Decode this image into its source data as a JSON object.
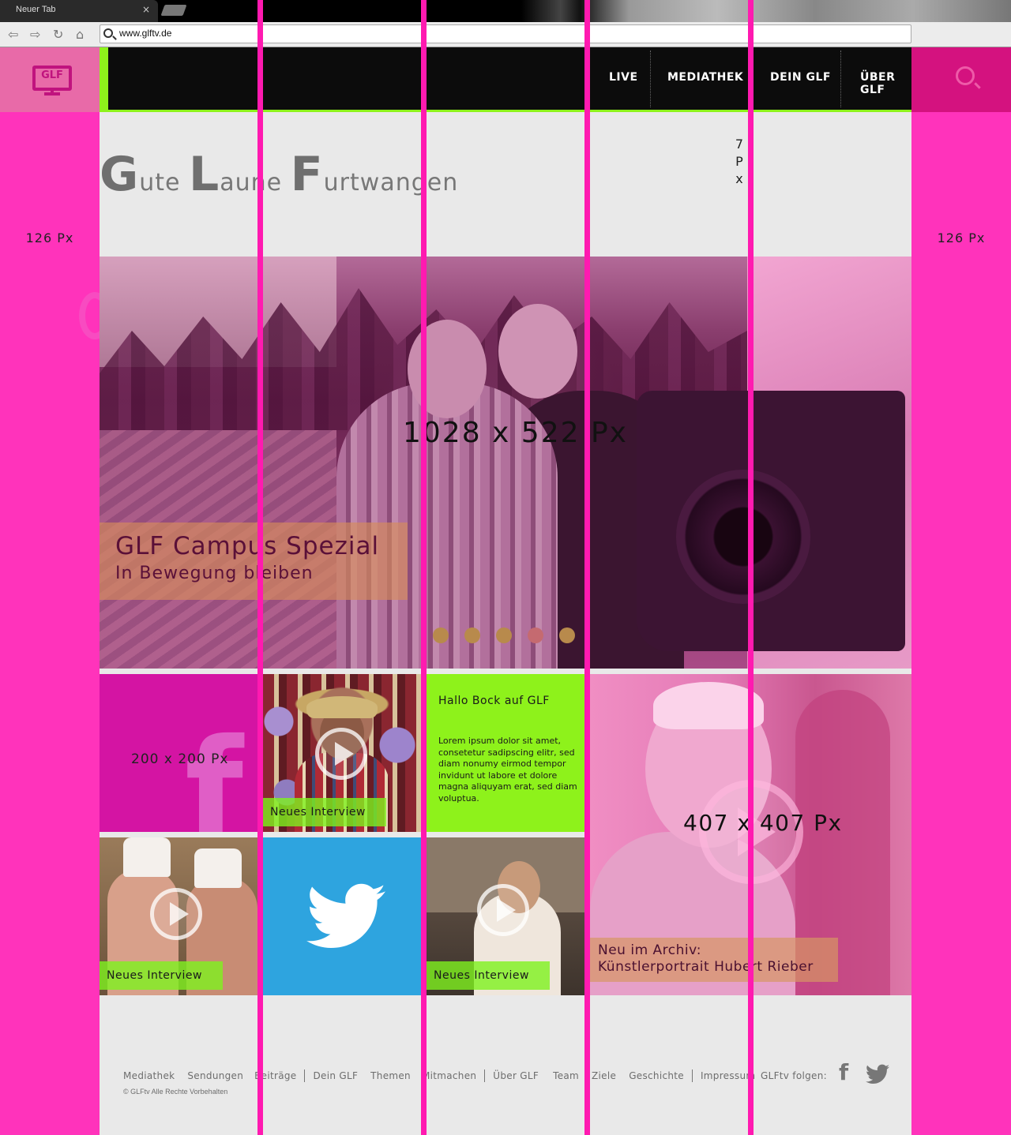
{
  "browser": {
    "tab_title": "Neuer Tab",
    "tab_close": "×",
    "url": "www.glftv.de",
    "back_icon": "back-arrow-icon",
    "forward_icon": "forward-arrow-icon",
    "reload_icon": "reload-icon",
    "home_icon": "home-icon"
  },
  "header": {
    "logo_text": "GLF",
    "nav": [
      {
        "label": "LIVE"
      },
      {
        "label": "MEDIATHEK"
      },
      {
        "label": "DEIN GLF"
      },
      {
        "label": "ÜBER GLF"
      }
    ]
  },
  "annotations": {
    "margin_left": "126 Px",
    "margin_right": "126 Px",
    "gutter": [
      "7",
      "P",
      "x"
    ],
    "hero_size": "1028 x 522 Px",
    "small_tile_size": "200 x 200 Px",
    "big_tile_size": "407 x 407 Px"
  },
  "tagline": {
    "parts": [
      {
        "initial": "G",
        "rest": "ute "
      },
      {
        "initial": "L",
        "rest": "aune "
      },
      {
        "initial": "F",
        "rest": "urtwangen"
      }
    ]
  },
  "hero": {
    "title": "GLF Campus Spezial",
    "subtitle": "In Bewegung bleiben",
    "slide_count": 5,
    "active_slide": 4
  },
  "tiles": {
    "interview_label": "Neues Interview",
    "green": {
      "title": "Hallo Bock auf GLF",
      "body": "Lorem ipsum dolor sit amet, consetetur sadipscing elitr, sed diam nonumy eirmod tempor invidunt ut labore et dolore magna aliquyam erat, sed diam voluptua."
    },
    "archive": {
      "line1": "Neu im Archiv:",
      "line2": "Künstlerportrait Hubert Rieber"
    },
    "facebook_letter": "f"
  },
  "footer": {
    "groups": [
      [
        "Mediathek",
        "Sendungen",
        "Beiträge"
      ],
      [
        "Dein GLF",
        "Themen",
        "Mitmachen"
      ],
      [
        "Über GLF",
        "Team",
        "Ziele",
        "Geschichte"
      ],
      [
        "Impressum"
      ]
    ],
    "copyright": "© GLFtv Alle Rechte Vorbehalten",
    "follow_label": "GLFtv folgen:",
    "facebook_letter": "f"
  },
  "colors": {
    "magenta": "#ff33bb",
    "guide": "#ff1ab0",
    "green": "#8ef21b",
    "twitter": "#2ea4df",
    "nav_bg": "#0c0c0c",
    "page_bg": "#e9e9e9"
  }
}
